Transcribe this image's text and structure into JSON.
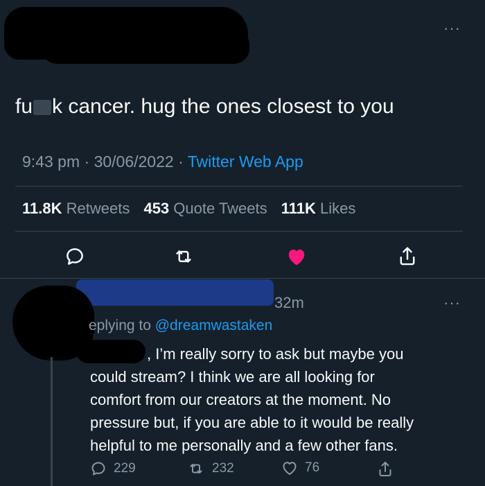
{
  "tweet": {
    "text_start": "fu",
    "text_rest": "k cancer. hug the ones closest to you",
    "time": "9:43 pm",
    "sep1": " · ",
    "date": "30/06/2022",
    "sep2": " · ",
    "app": "Twitter Web App",
    "more": "···",
    "stats": {
      "retweets_count": "11.8K",
      "retweets_label": " Retweets",
      "quotes_count": "453",
      "quotes_label": " Quote Tweets",
      "likes_count": "111K",
      "likes_label": " Likes"
    },
    "liked": true,
    "colors": {
      "like": "#f91880",
      "link": "#1d9bf0",
      "muted": "#8b98a5"
    }
  },
  "reply": {
    "time": "32m",
    "more": "···",
    "replying_prefix": "eplying to ",
    "replying_handle": "@dreamwastaken",
    "lines": [
      ", I’m really sorry to ask but maybe you",
      "could stream? I think we are all looking for",
      "comfort from our creators at the moment. No",
      "pressure but, if you are able to it would be really",
      "helpful to me personally and a few other fans."
    ],
    "reply_count": "229",
    "retweet_count": "232",
    "like_count": "76"
  },
  "icons": [
    "reply-icon",
    "retweet-icon",
    "like-icon",
    "share-icon",
    "more-icon"
  ]
}
